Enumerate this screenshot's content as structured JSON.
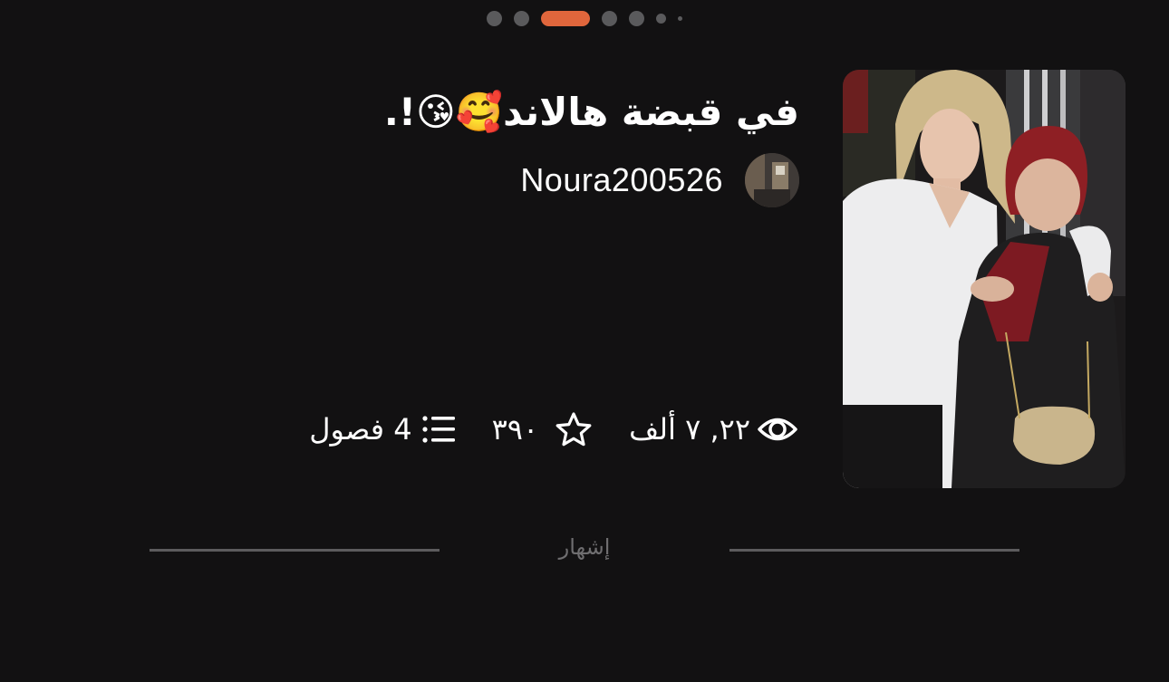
{
  "pager": {
    "page_count": 7,
    "active_index": 2
  },
  "story": {
    "title": "في قبضة هالاند🥰😘!.",
    "author": "Noura200526",
    "stats": {
      "reads": "٢٢, ٧ ألف",
      "votes": "٣٩٠",
      "parts": "4 فصول"
    }
  },
  "ad": {
    "label": "إشهار"
  },
  "icons": {
    "reads": "eye-icon",
    "votes": "star-icon",
    "parts": "list-icon"
  },
  "colors": {
    "background": "#121112",
    "accent": "#e0663c",
    "dot_inactive": "#5a5a5c",
    "divider": "#5c5b5d",
    "ad_text": "#6f6e70"
  }
}
